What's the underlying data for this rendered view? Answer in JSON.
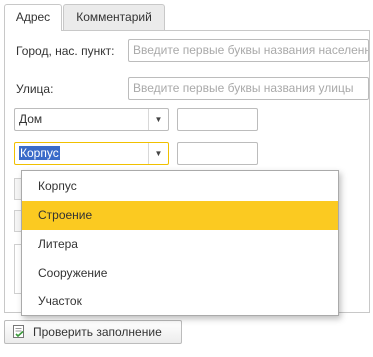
{
  "tabs": [
    {
      "label": "Адрес",
      "active": true
    },
    {
      "label": "Комментарий",
      "active": false
    }
  ],
  "form": {
    "city_label": "Город, нас. пункт:",
    "city_placeholder": "Введите первые буквы названия населенного пункта",
    "street_label": "Улица:",
    "street_placeholder": "Введите первые буквы названия улицы",
    "house_type": "Дом",
    "house_value": "",
    "building_type": "Корпус",
    "building_value": ""
  },
  "dropdown": {
    "items": [
      "Корпус",
      "Строение",
      "Литера",
      "Сооружение",
      "Участок"
    ],
    "highlighted": "Строение"
  },
  "footer": {
    "check_label": "Проверить заполнение"
  },
  "colors": {
    "highlight": "#fbca21",
    "focus_border": "#f0c000",
    "selection": "#3a6bc9"
  }
}
